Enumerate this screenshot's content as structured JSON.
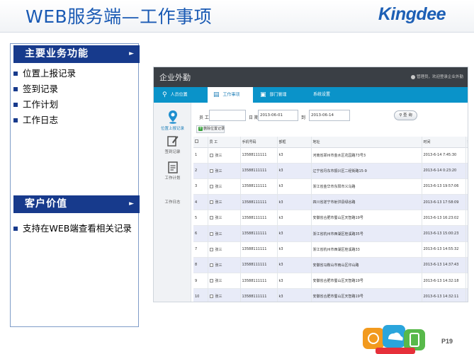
{
  "slide": {
    "title": "WEB服务端—工作事项",
    "logo": "Kingdee",
    "page_number": "P19"
  },
  "left_panel": {
    "main_functions": {
      "heading": "主要业务功能",
      "items": [
        "位置上报记录",
        "签到记录",
        "工作计划",
        "工作日志"
      ]
    },
    "customer_value": {
      "heading": "客户价值",
      "items": [
        "支持在WEB端查看相关记录"
      ]
    },
    "arrow_icon": "triangle-right-icon",
    "accent_color": "#173a8c"
  },
  "app": {
    "name": "企业外勤",
    "user_info": "管理员，欢迎登录企业外勤",
    "colors": {
      "topbar": "#3a3f45",
      "tabbar": "#0a93c9",
      "alt_row": "#e8ebf8"
    },
    "tabs": [
      {
        "label": "人员位置",
        "icon": "location-pin-icon"
      },
      {
        "label": "工作事项",
        "icon": "document-icon",
        "active": true
      },
      {
        "label": "部门管理",
        "icon": "department-icon"
      },
      {
        "label": "系统设置",
        "icon": ""
      }
    ],
    "sidebar": [
      {
        "label": "位置上报记录",
        "icon": "location-pin-icon",
        "active": true
      },
      {
        "label": "签到记录",
        "icon": "pencil-icon"
      },
      {
        "label": "工作计划",
        "icon": "clipboard-icon"
      },
      {
        "label": "工作日志",
        "icon": ""
      }
    ],
    "filters": {
      "staff_label": "员 工",
      "date_label": "日 期",
      "start_date": "2013-06-01",
      "to_label": "到",
      "end_date": "2013-06-14",
      "search_button": "查 询"
    },
    "delete_button": "删除位置记录",
    "table": {
      "columns": [
        "",
        "员 工",
        "手机号码",
        "部框",
        "地址",
        "时间",
        "操作"
      ],
      "rows": [
        {
          "no": "1",
          "name": "张三",
          "phone": "13588111111",
          "dept": "k3",
          "address": "河南省郑州市金水区花园路73号3",
          "time": "2013-6-14 7:45:30"
        },
        {
          "no": "2",
          "name": "张三",
          "phone": "13588111111",
          "dept": "k3",
          "address": "辽宁省丹东市振兴区二经街路15-9",
          "time": "2013-6-14 0:23:20"
        },
        {
          "no": "3",
          "name": "张三",
          "phone": "13588111111",
          "dept": "k3",
          "address": "浙江省金华市东阳市义乌路",
          "time": "2013-6-13 19:57:06"
        },
        {
          "no": "4",
          "name": "张三",
          "phone": "13588111111",
          "dept": "k3",
          "address": "四川省遂宁市射洪县绿谷路",
          "time": "2013-6-13 17:58:09"
        },
        {
          "no": "5",
          "name": "张三",
          "phone": "13588111111",
          "dept": "k3",
          "address": "安徽省合肥市蜀山区天智路19号",
          "time": "2013-6-13 16:23:02"
        },
        {
          "no": "6",
          "name": "张三",
          "phone": "13588111111",
          "dept": "k3",
          "address": "浙江省杭州市西湖区桂溪路35号",
          "time": "2013-6-13 15:00:23"
        },
        {
          "no": "7",
          "name": "张三",
          "phone": "13588111111",
          "dept": "k3",
          "address": "浙江省杭州市西湖区桂溪路33",
          "time": "2013-6-13 14:55:32"
        },
        {
          "no": "8",
          "name": "张三",
          "phone": "13588111111",
          "dept": "k3",
          "address": "安徽省马鞍山市雨山区印山路",
          "time": "2013-6-13 14:37:43"
        },
        {
          "no": "9",
          "name": "张三",
          "phone": "13588111111",
          "dept": "k3",
          "address": "安徽省合肥市蜀山区天智路19号",
          "time": "2013-6-13 14:32:18"
        },
        {
          "no": "10",
          "name": "张三",
          "phone": "13588111111",
          "dept": "k3",
          "address": "安徽省合肥市蜀山区天智路19号",
          "time": "2013-6-13 14:32:11"
        }
      ],
      "action_icon": "map-pin-button-icon"
    }
  }
}
